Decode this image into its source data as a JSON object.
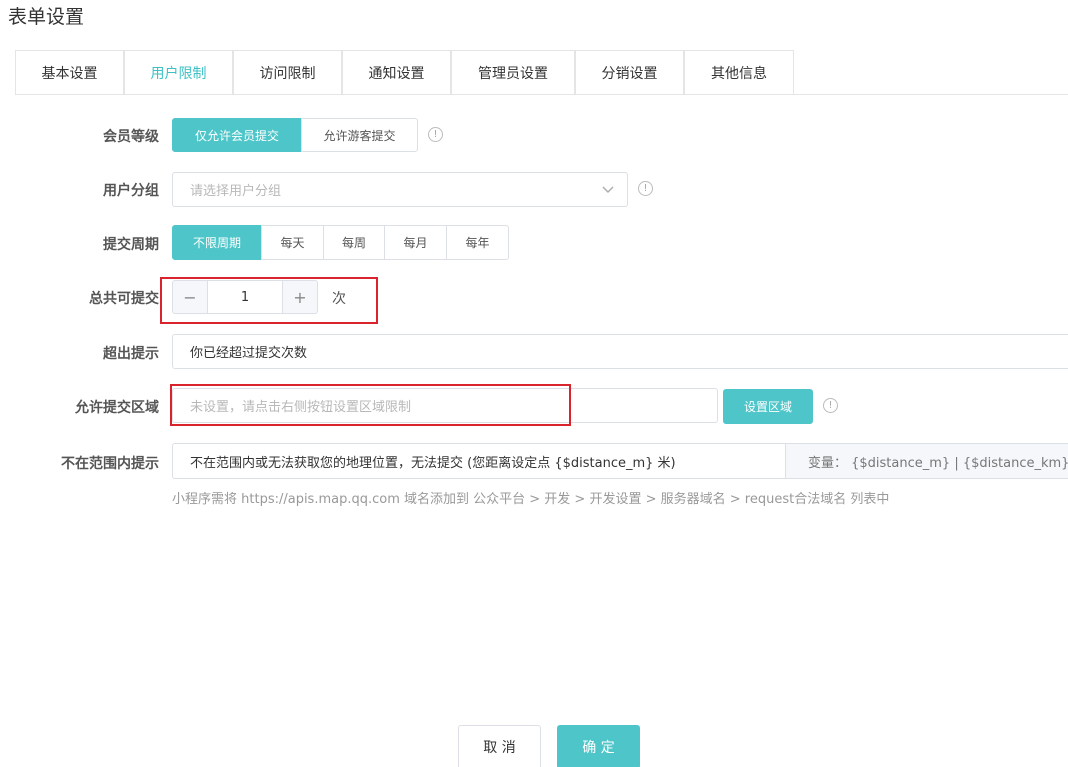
{
  "page": {
    "title": "表单设置"
  },
  "tabs": [
    {
      "label": "基本设置",
      "active": false
    },
    {
      "label": "用户限制",
      "active": true
    },
    {
      "label": "访问限制",
      "active": false
    },
    {
      "label": "通知设置",
      "active": false
    },
    {
      "label": "管理员设置",
      "active": false
    },
    {
      "label": "分销设置",
      "active": false
    },
    {
      "label": "其他信息",
      "active": false
    }
  ],
  "member_level": {
    "label": "会员等级",
    "options": [
      "仅允许会员提交",
      "允许游客提交"
    ],
    "selected": "仅允许会员提交",
    "info_icon": "info-icon"
  },
  "user_group": {
    "label": "用户分组",
    "placeholder": "请选择用户分组",
    "chevron_icon": "chevron-down-icon",
    "info_icon": "info-icon"
  },
  "submit_period": {
    "label": "提交周期",
    "options": [
      "不限周期",
      "每天",
      "每周",
      "每月",
      "每年"
    ],
    "selected": "不限周期"
  },
  "total_submit": {
    "label": "总共可提交",
    "minus": "−",
    "value": "1",
    "plus": "+",
    "unit": "次"
  },
  "exceed_tip": {
    "label": "超出提示",
    "value": "你已经超过提交次数"
  },
  "allowed_area": {
    "label": "允许提交区域",
    "placeholder": "未设置，请点击右侧按钮设置区域限制",
    "button": "设置区域",
    "info_icon": "info-icon"
  },
  "out_of_range_tip": {
    "label": "不在范围内提示",
    "value": "不在范围内或无法获取您的地理位置，无法提交 (您距离设定点 {$distance_m} 米)",
    "variables": "变量： {$distance_m} | {$distance_km}",
    "hint": "小程序需将 https://apis.map.qq.com 域名添加到 公众平台 > 开发 > 开发设置 > 服务器域名 > request合法域名 列表中"
  },
  "footer": {
    "cancel": "取 消",
    "confirm": "确 定"
  },
  "colors": {
    "accent": "#4ec5c8",
    "active_tab_text": "#3ec1c6",
    "highlight_border": "#d9232d"
  }
}
